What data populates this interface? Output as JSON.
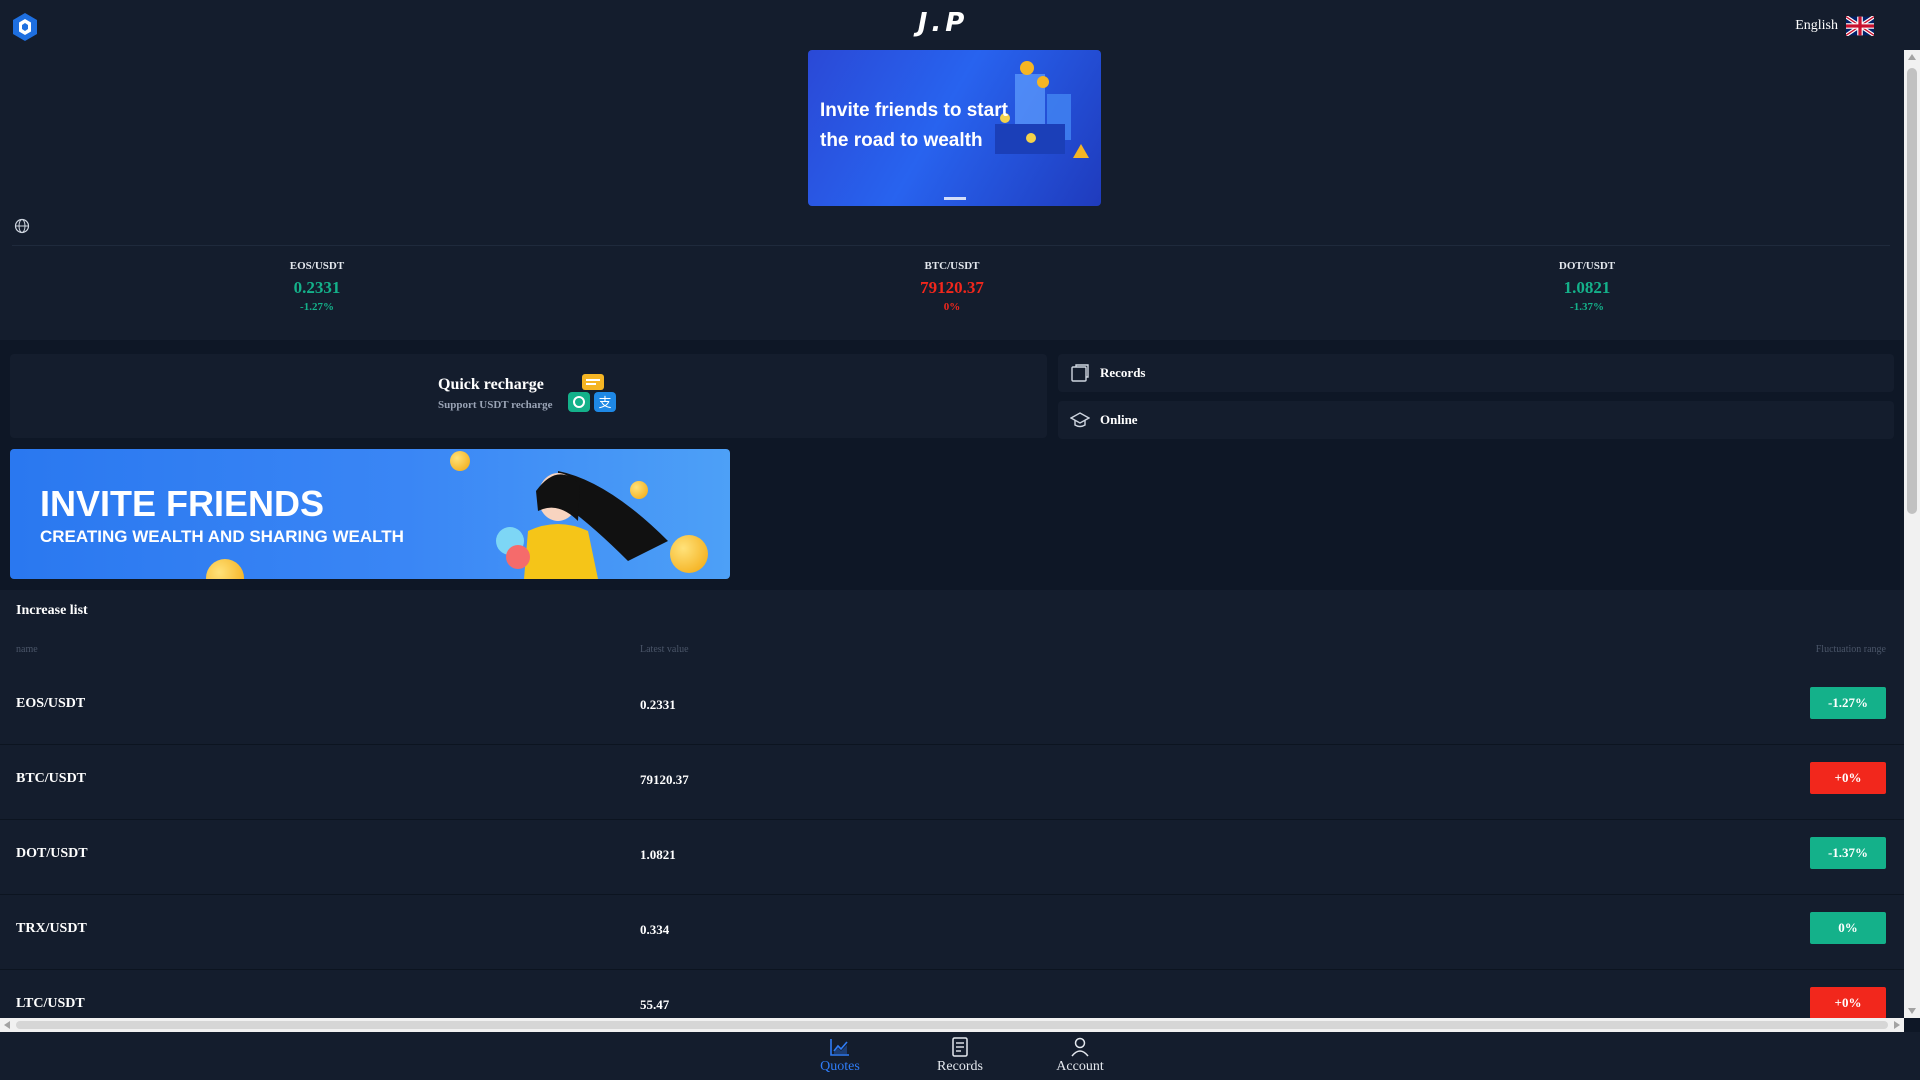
{
  "header": {
    "brand": "J.P",
    "language": "English"
  },
  "banner_top": {
    "text_line1": "Invite friends to start",
    "text_line2": "the road to wealth"
  },
  "tickers": [
    {
      "pair": "EOS/USDT",
      "price": "0.2331",
      "change": "-1.27%",
      "color": "#14b18a"
    },
    {
      "pair": "BTC/USDT",
      "price": "79120.37",
      "change": "0%",
      "color": "#f2271c"
    },
    {
      "pair": "DOT/USDT",
      "price": "1.0821",
      "change": "-1.37%",
      "color": "#14b18a"
    }
  ],
  "quick_recharge": {
    "title": "Quick recharge",
    "subtitle": "Support USDT recharge"
  },
  "side_menu": {
    "records": "Records",
    "online": "Online"
  },
  "invite_banner": {
    "headline": "INVITE FRIENDS",
    "subline": "CREATING WEALTH AND SHARING WEALTH"
  },
  "increase_list": {
    "title": "Increase list",
    "columns": {
      "name": "name",
      "latest": "Latest value",
      "range": "Fluctuation range"
    },
    "rows": [
      {
        "name": "EOS/USDT",
        "value": "0.2331",
        "change": "-1.27%",
        "status": "green"
      },
      {
        "name": "BTC/USDT",
        "value": "79120.37",
        "change": "+0%",
        "status": "red"
      },
      {
        "name": "DOT/USDT",
        "value": "1.0821",
        "change": "-1.37%",
        "status": "green"
      },
      {
        "name": "TRX/USDT",
        "value": "0.334",
        "change": "0%",
        "status": "green"
      },
      {
        "name": "LTC/USDT",
        "value": "55.47",
        "change": "+0%",
        "status": "red"
      }
    ]
  },
  "bottom_nav": {
    "quotes": "Quotes",
    "records": "Records",
    "account": "Account"
  },
  "colors": {
    "background": "#0e1726",
    "panel": "#141d2d",
    "accent_blue": "#2f7cf6",
    "up_green": "#14b18a",
    "down_red": "#f2271c"
  },
  "icons": [
    "logo-icon",
    "uk-flag-icon",
    "globe-icon",
    "wallet-chat-icon",
    "records-icon",
    "graduation-cap-icon",
    "chart-icon",
    "document-icon",
    "user-icon"
  ]
}
